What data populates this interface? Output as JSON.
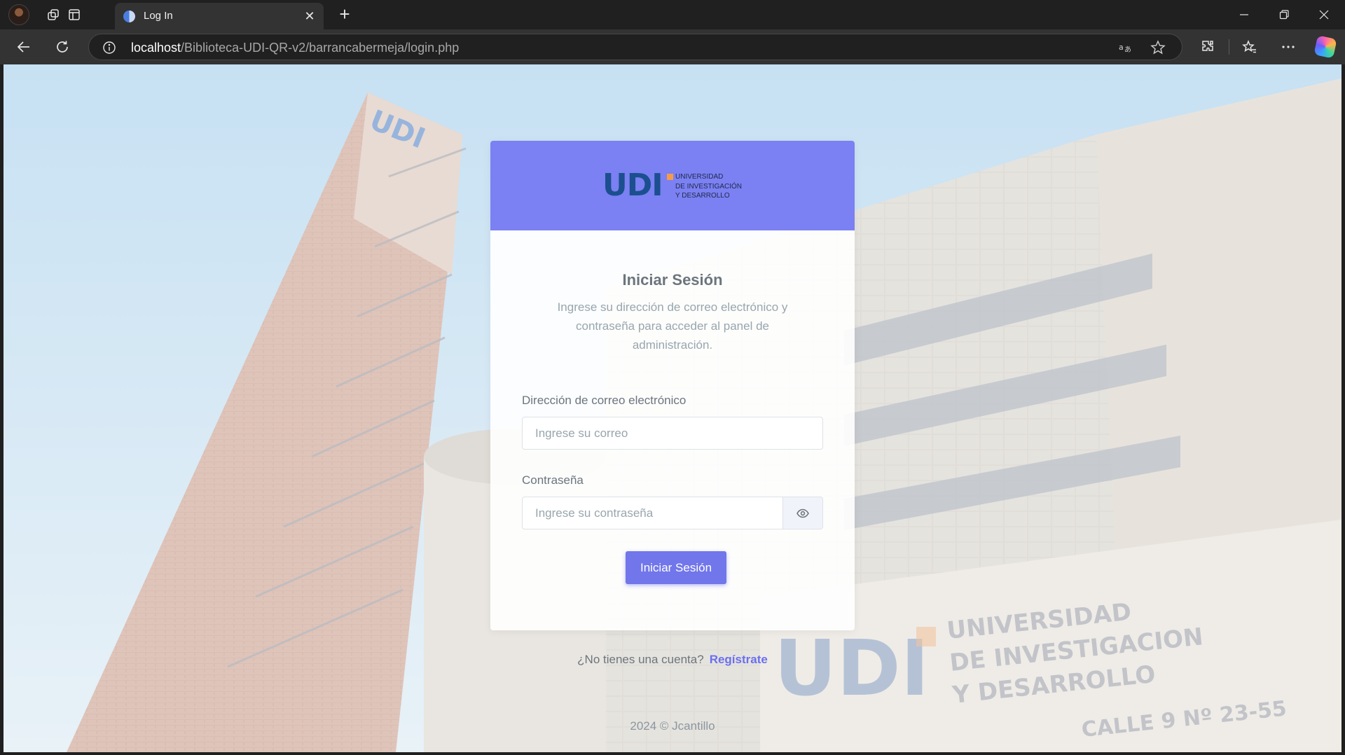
{
  "browser": {
    "tab_title": "Log In",
    "url_host": "localhost",
    "url_path": "/Biblioteca-UDI-QR-v2/barrancabermeja/login.php"
  },
  "page": {
    "logo": {
      "mark": "UDI",
      "line1": "UNIVERSIDAD",
      "line2": "DE INVESTIGACIÓN",
      "line3": "Y DESARROLLO"
    },
    "title": "Iniciar Sesión",
    "subtitle": "Ingrese su dirección de correo electrónico y contraseña para acceder al panel de administración.",
    "email_label": "Dirección de correo electrónico",
    "email_placeholder": "Ingrese su correo",
    "password_label": "Contraseña",
    "password_placeholder": "Ingrese su contraseña",
    "submit_label": "Iniciar Sesión",
    "register_prompt": "¿No tienes una cuenta?",
    "register_link": "Regístrate",
    "footer": "2024 © Jcantillo"
  },
  "background_signage": {
    "line1": "UNIVERSIDAD",
    "line2": "DE INVESTIGACION",
    "line3": "Y DESARROLLO",
    "address": "CALLE 9 Nº 23-55"
  },
  "colors": {
    "header": "#7b80f2",
    "button": "#7176ea",
    "link": "#6a70ee",
    "logo_blue": "#1b4f8f",
    "logo_orange": "#f39c4a"
  }
}
